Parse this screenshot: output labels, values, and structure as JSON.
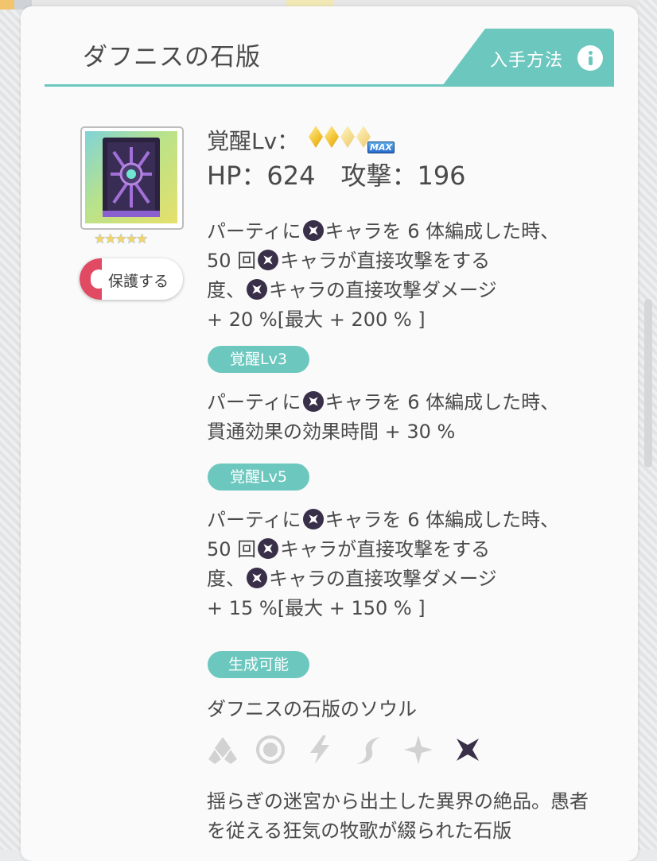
{
  "header": {
    "title": "ダフニスの石版",
    "obtain_label": "入手方法"
  },
  "icons": {
    "info": "info-icon",
    "attribute": "dark-attribute-icon"
  },
  "item": {
    "rarity_stars": 5
  },
  "protect": {
    "label": "保護する"
  },
  "stats": {
    "awaken_label": "覚醒Lv：",
    "awaken_max_badge": "MAX",
    "hp_label": "HP：624",
    "atk_label": "攻撃：196"
  },
  "effects": {
    "base": [
      "パーティに",
      "キャラを 6 体編成した時、",
      "50 回",
      "キャラが直接攻撃をする",
      "度、",
      "キャラの直接攻撃ダメージ",
      "+ 20 %[最大 + 200 % ]"
    ],
    "lv3_label": "覚醒Lv3",
    "lv3": [
      "パーティに",
      "キャラを 6 体編成した時、",
      "貫通効果の効果時間 + 30 %"
    ],
    "lv5_label": "覚醒Lv5",
    "lv5": [
      "パーティに",
      "キャラを 6 体編成した時、",
      "50 回",
      "キャラが直接攻撃をする",
      "度、",
      "キャラの直接攻撃ダメージ",
      "+ 15 %[最大 + 150 % ]"
    ]
  },
  "creatable": {
    "label": "生成可能",
    "soul_name": "ダフニスの石版のソウル",
    "attributes": [
      {
        "name": "earth-attribute-icon",
        "active": false
      },
      {
        "name": "water-attribute-icon",
        "active": false
      },
      {
        "name": "thunder-attribute-icon",
        "active": false
      },
      {
        "name": "wind-attribute-icon",
        "active": false
      },
      {
        "name": "light-attribute-icon",
        "active": false
      },
      {
        "name": "dark-attribute-icon",
        "active": true
      }
    ]
  },
  "description": "揺らぎの迷宮から出土した異界の絶品。愚者を従える狂気の牧歌が綴られた石版",
  "colors": {
    "accent": "#6cc7be",
    "protect": "#e04a63",
    "dark_attr": "#3a2f49",
    "inactive_attr": "#d2d2d2"
  }
}
